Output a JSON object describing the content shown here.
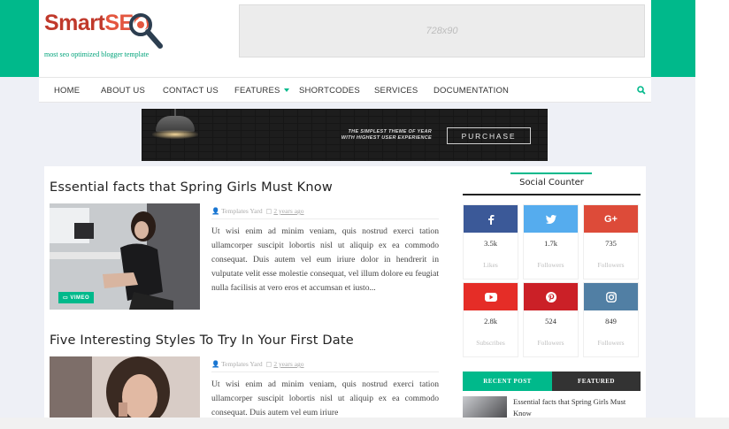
{
  "header": {
    "logo_part1": "Smart",
    "logo_part2": "SEO",
    "tagline": "most seo optimized blogger template",
    "ad_label": "728x90"
  },
  "nav": {
    "items": [
      {
        "label": "HOME"
      },
      {
        "label": "ABOUT US"
      },
      {
        "label": "CONTACT US"
      },
      {
        "label": "FEATURES"
      },
      {
        "label": "SHORTCODES"
      },
      {
        "label": "SERVICES"
      },
      {
        "label": "DOCUMENTATION"
      }
    ],
    "search_icon": "search-icon"
  },
  "banner": {
    "tagline_line1": "THE SIMPLEST THEME OF YEAR",
    "tagline_line2": "WITH HIGHEST USER EXPERIENCE",
    "button_label": "PURCHASE"
  },
  "posts": [
    {
      "title": "Essential facts that Spring Girls Must Know",
      "badge": "VIMEO",
      "author": "Templates Yard",
      "date": "2 years ago",
      "excerpt": "Ut wisi enim ad minim veniam, quis nostrud exerci tation ullamcorper suscipit lobortis nisl ut aliquip ex ea commodo consequat. Duis autem vel eum iriure dolor in hendrerit in vulputate velit esse molestie consequat, vel illum dolore eu feugiat nulla facilisis at vero eros et accumsan et iusto..."
    },
    {
      "title": "Five Interesting Styles To Try In Your First Date",
      "author": "Templates Yard",
      "date": "2 years ago",
      "excerpt": "Ut wisi enim ad minim veniam, quis nostrud exerci tation ullamcorper suscipit lobortis nisl ut aliquip ex ea commodo consequat. Duis autem vel eum iriure"
    }
  ],
  "sidebar": {
    "social_title": "Social Counter",
    "social": [
      {
        "icon": "facebook-icon",
        "glyph": "f",
        "color": "#3b5998",
        "count": "3.5k",
        "label": "Likes"
      },
      {
        "icon": "twitter-icon",
        "glyph": "t",
        "color": "#55acee",
        "count": "1.7k",
        "label": "Followers"
      },
      {
        "icon": "google-plus-icon",
        "glyph": "G+",
        "color": "#dd4b39",
        "count": "735",
        "label": "Followers"
      },
      {
        "icon": "youtube-icon",
        "glyph": "yt",
        "color": "#e52d27",
        "count": "2.8k",
        "label": "Subscribes"
      },
      {
        "icon": "pinterest-icon",
        "glyph": "p",
        "color": "#cb2027",
        "count": "524",
        "label": "Followers"
      },
      {
        "icon": "instagram-icon",
        "glyph": "ig",
        "color": "#517fa4",
        "count": "849",
        "label": "Followers"
      }
    ],
    "tab_recent": "RECENT POST",
    "tab_featured": "FEATURED",
    "recent_post_title": "Essential facts that Spring Girls Must Know"
  },
  "colors": {
    "accent": "#00b98b",
    "dark_tab": "#333333"
  }
}
